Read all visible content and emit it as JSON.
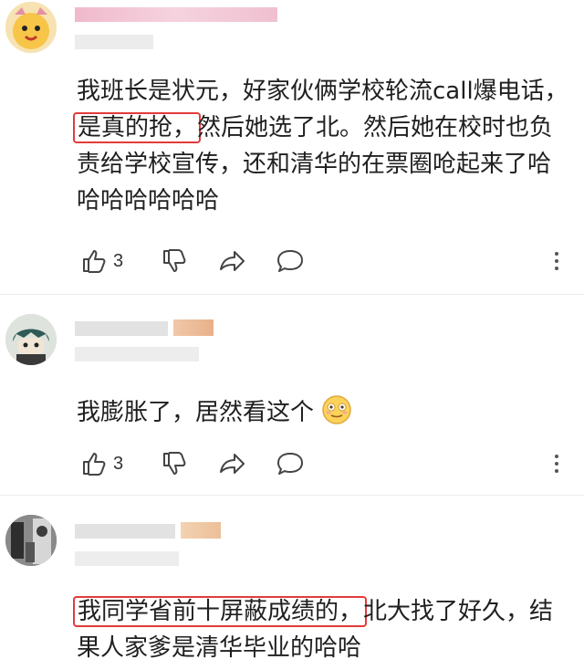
{
  "comments": [
    {
      "text_before": "我班长是状元，好家伙俩学校轮流call爆电话，",
      "highlight": "是真的抢，",
      "text_after": "然后她选了北。然后她在校时也负责给学校宣传，还和清华的在票圈呛起来了哈哈哈哈哈哈哈",
      "likes": "3"
    },
    {
      "text_before": "我膨胀了，居然看这个",
      "highlight": "",
      "text_after": "",
      "emoji": "smiling-emoji",
      "likes": "3"
    },
    {
      "text_before": "",
      "highlight": "我同学省前十屏蔽成绩的，",
      "text_after": "北大找了好久，结果人家爹是清华毕业的哈哈"
    }
  ],
  "icons": {
    "like": "thumbs-up-icon",
    "dislike": "thumbs-down-icon",
    "share": "share-arrow-icon",
    "reply": "comment-bubble-icon",
    "more": "more-vertical-icon"
  },
  "colors": {
    "highlight_border": "#e33b3b",
    "blur": "#e6e6e6",
    "accent_pink": "#f2c8d6"
  }
}
